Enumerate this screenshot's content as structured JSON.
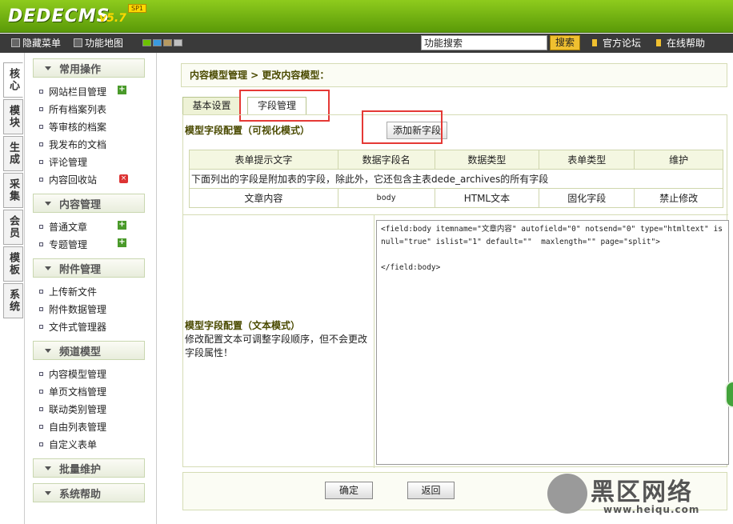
{
  "header": {
    "logo": "DEDECMS",
    "version": "v5.7",
    "edition": "SP1"
  },
  "navbar": {
    "hide_menu": "隐藏菜单",
    "site_map": "功能地图",
    "search_value": "功能搜索",
    "search_button": "搜索",
    "forum": "官方论坛",
    "help": "在线帮助",
    "theme_colors": [
      "#6cc100",
      "#3a9ae0",
      "#b89a60",
      "#c0c0c0"
    ]
  },
  "vtabs": [
    "核心",
    "模块",
    "生成",
    "采集",
    "会员",
    "模板",
    "系统"
  ],
  "sidebar": {
    "groups": [
      {
        "title": "常用操作",
        "items": [
          "网站栏目管理",
          "所有档案列表",
          "等审核的档案",
          "我发布的文档",
          "评论管理",
          "内容回收站"
        ]
      },
      {
        "title": "内容管理",
        "items": [
          "普通文章",
          "专题管理"
        ]
      },
      {
        "title": "附件管理",
        "items": [
          "上传新文件",
          "附件数据管理",
          "文件式管理器"
        ]
      },
      {
        "title": "频道模型",
        "items": [
          "内容模型管理",
          "单页文档管理",
          "联动类别管理",
          "自由列表管理",
          "自定义表单"
        ]
      },
      {
        "title": "批量维护",
        "items": []
      },
      {
        "title": "系统帮助",
        "items": []
      }
    ]
  },
  "main": {
    "breadcrumb": "内容模型管理 > 更改内容模型：",
    "tabs": [
      "基本设置",
      "字段管理"
    ],
    "visual_title": "模型字段配置（可视化模式）",
    "add_field": "添加新字段",
    "table": {
      "headers": [
        "表单提示文字",
        "数据字段名",
        "数据类型",
        "表单类型",
        "维护"
      ],
      "note": "下面列出的字段是附加表的字段，除此外，它还包含主表dede_archives的所有字段",
      "rows": [
        [
          "文章内容",
          "body",
          "HTML文本",
          "固化字段",
          "禁止修改"
        ]
      ]
    },
    "text_mode_title": "模型字段配置（文本模式）",
    "text_mode_desc": "修改配置文本可调整字段顺序，但不会更改字段属性！",
    "code": "<field:body itemname=\"文章内容\" autofield=\"0\" notsend=\"0\" type=\"htmltext\" isnull=\"true\" islist=\"1\" default=\"\"  maxlength=\"\" page=\"split\">\n\n</field:body>",
    "ok": "确定",
    "back": "返回"
  },
  "watermark": {
    "text": "黑区网络",
    "url": "www.heiqu.com"
  }
}
